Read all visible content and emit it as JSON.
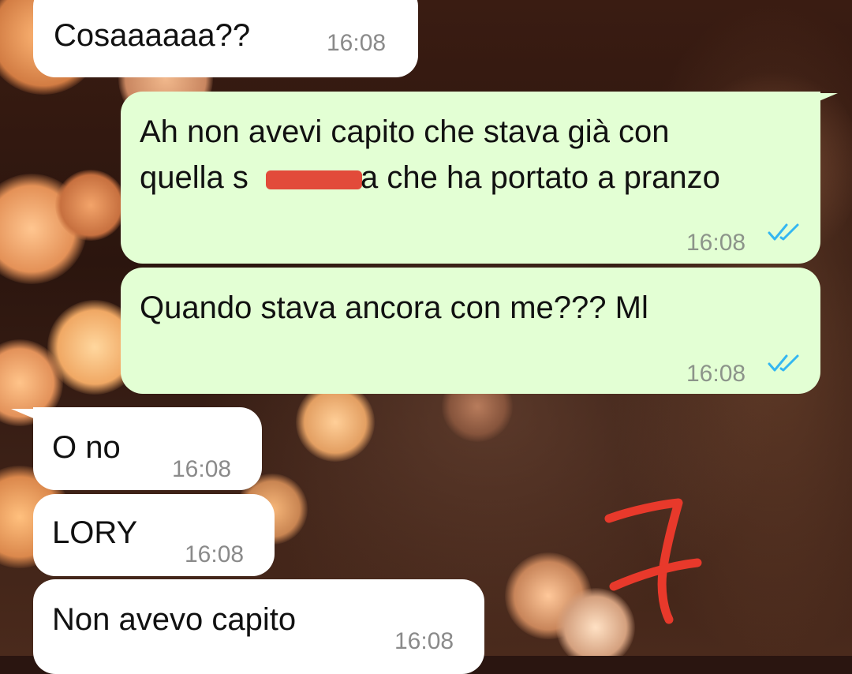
{
  "messages": [
    {
      "direction": "incoming",
      "text": "Cosaaaaaa??",
      "time": "16:08"
    },
    {
      "direction": "outgoing",
      "line1": "Ah non avevi capito che stava già con",
      "line2_before": "quella s",
      "line2_after": "a che ha portato a pranzo",
      "time": "16:08",
      "status": "read"
    },
    {
      "direction": "outgoing",
      "text": "Quando stava ancora con me??? Ml",
      "time": "16:08",
      "status": "read"
    },
    {
      "direction": "incoming",
      "text": "O no",
      "time": "16:08"
    },
    {
      "direction": "incoming",
      "text": "LORY",
      "time": "16:08"
    },
    {
      "direction": "incoming",
      "text": "Non avevo capito",
      "time": "16:08"
    }
  ],
  "colors": {
    "incoming_bubble": "#ffffff",
    "outgoing_bubble": "#e3ffd4",
    "read_ticks": "#34b7f1",
    "redaction": "#e24b3a",
    "annotation": "#e8392b"
  },
  "icons": {
    "read_receipt": "double-check-icon"
  },
  "annotation": "7"
}
